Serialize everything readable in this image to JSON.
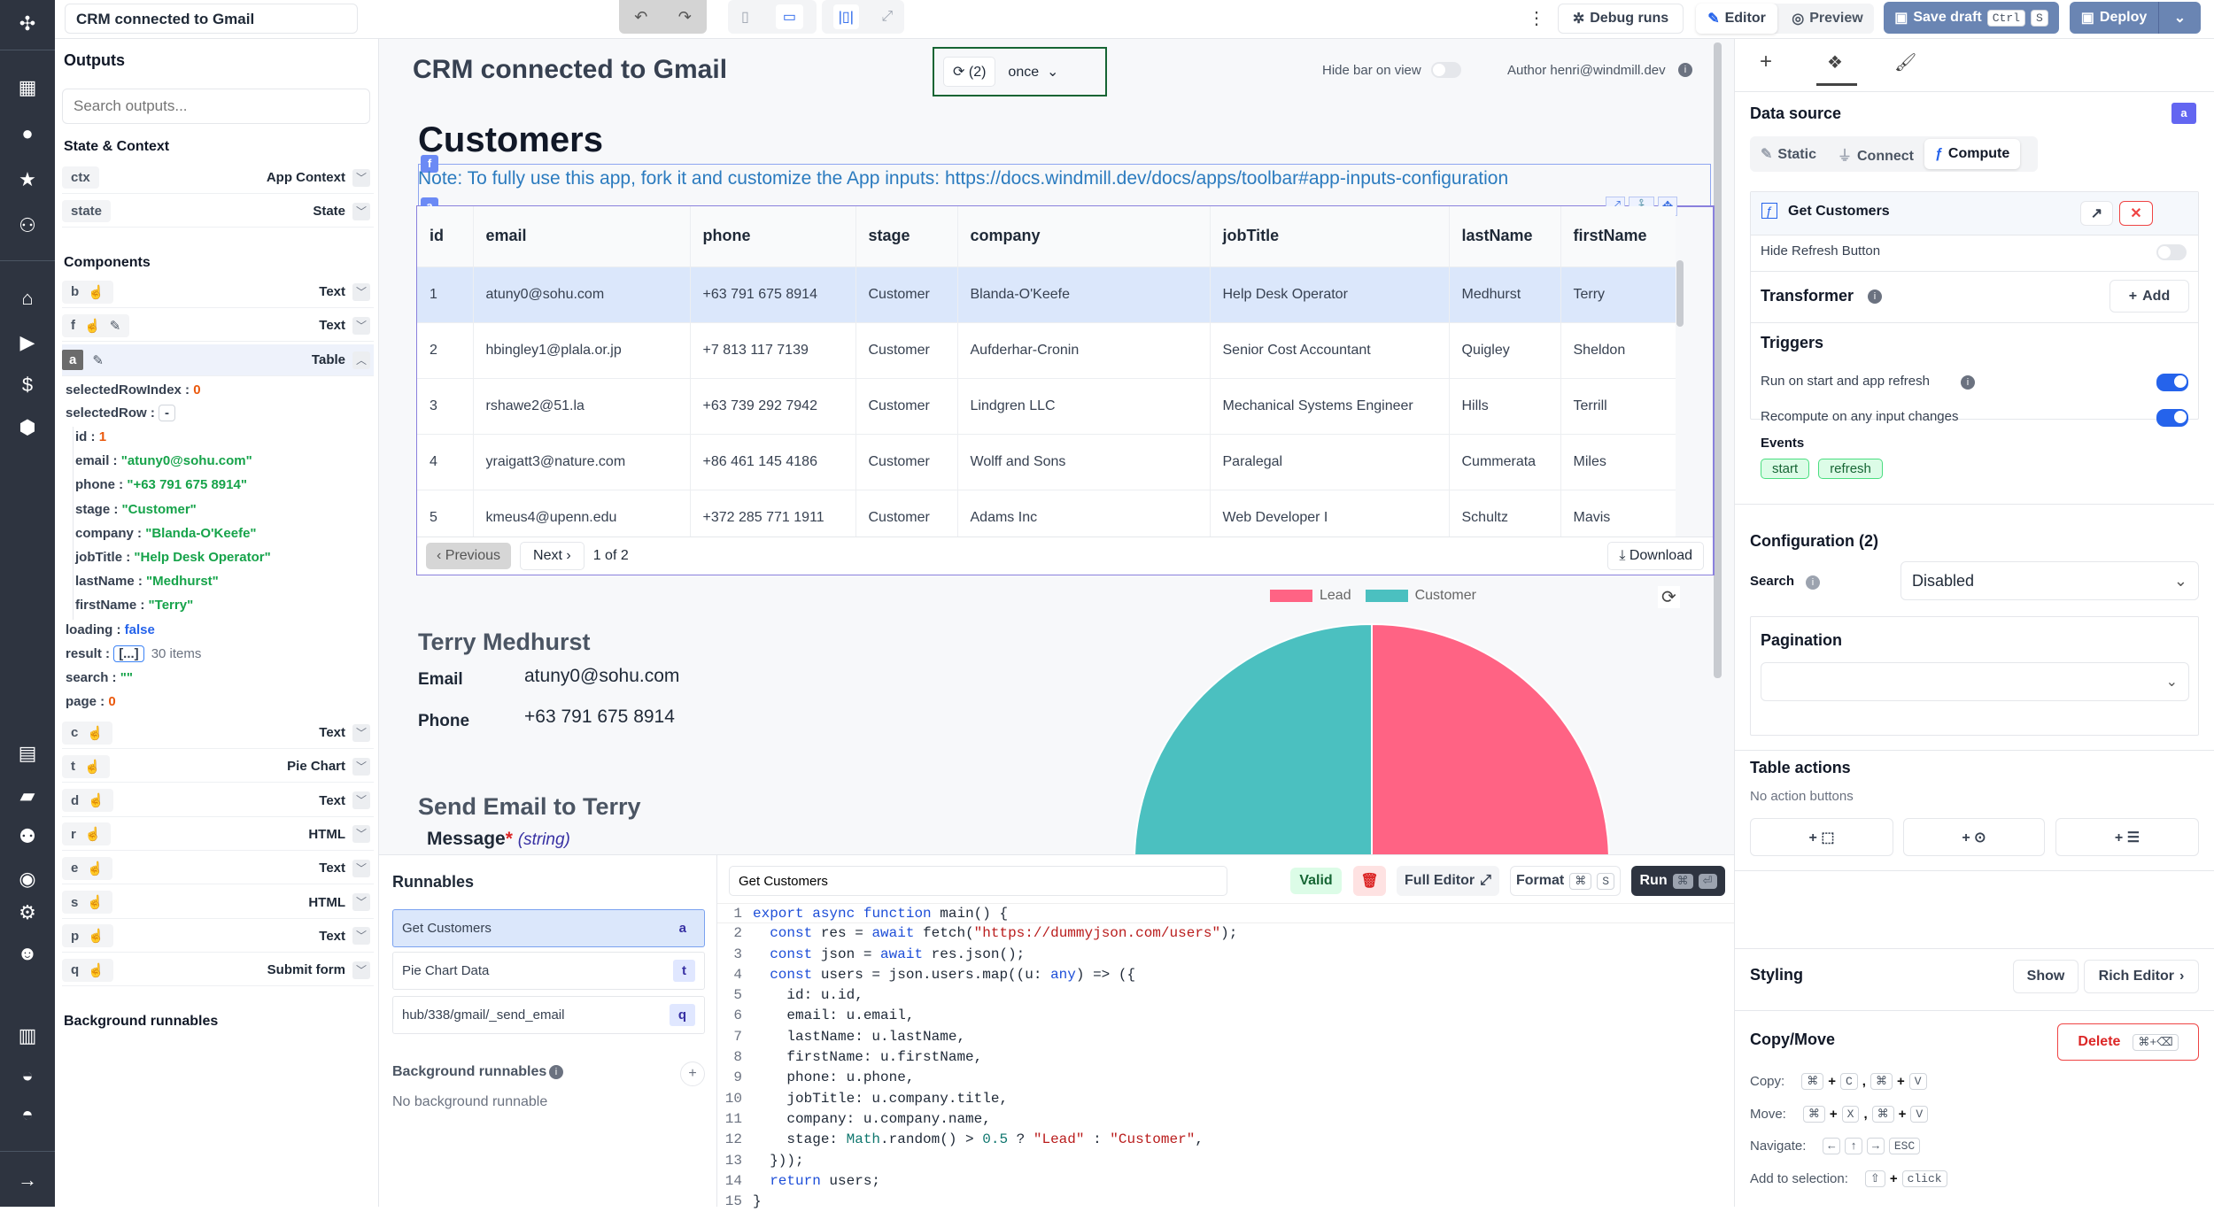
{
  "app": {
    "title": "CRM connected to Gmail"
  },
  "nav": {
    "icons": [
      "windmill-logo-icon",
      "building-icon",
      "user-icon",
      "star-icon",
      "users-icon",
      "home-icon",
      "play-icon",
      "dollar-icon",
      "cubes-icon",
      "calendar-icon",
      "folder-icon",
      "user-group-icon",
      "eye-icon",
      "gear-icon",
      "robot-icon",
      "book-icon",
      "discord-icon",
      "github-icon",
      "arrow-right-icon"
    ]
  },
  "topbar": {
    "debug_runs": "Debug runs",
    "editor": "Editor",
    "preview": "Preview",
    "save_draft": "Save draft",
    "save_kbd1": "Ctrl",
    "save_kbd2": "S",
    "deploy": "Deploy"
  },
  "outputs": {
    "title": "Outputs",
    "search_placeholder": "Search outputs...",
    "state_title": "State & Context",
    "state_items": [
      {
        "id": "ctx",
        "type": "App Context"
      },
      {
        "id": "state",
        "type": "State"
      }
    ],
    "components_title": "Components",
    "components_top": [
      {
        "id": "b",
        "type": "Text"
      },
      {
        "id": "f",
        "type": "Text"
      },
      {
        "id": "a",
        "type": "Table"
      }
    ],
    "table_outputs": {
      "selectedRowIndex": "0",
      "selectedRow_btn": "-",
      "row": [
        [
          "id",
          "1"
        ],
        [
          "email",
          "\"atuny0@sohu.com\""
        ],
        [
          "phone",
          "\"+63 791 675 8914\""
        ],
        [
          "stage",
          "\"Customer\""
        ],
        [
          "company",
          "\"Blanda-O'Keefe\""
        ],
        [
          "jobTitle",
          "\"Help Desk Operator\""
        ],
        [
          "lastName",
          "\"Medhurst\""
        ],
        [
          "firstName",
          "\"Terry\""
        ]
      ],
      "loading": "false",
      "result_btn": "[...]",
      "result_count": "30 items",
      "search": "\"\"",
      "page": "0"
    },
    "components_bottom": [
      {
        "id": "c",
        "type": "Text"
      },
      {
        "id": "t",
        "type": "Pie Chart"
      },
      {
        "id": "d",
        "type": "Text"
      },
      {
        "id": "r",
        "type": "HTML"
      },
      {
        "id": "e",
        "type": "Text"
      },
      {
        "id": "s",
        "type": "HTML"
      },
      {
        "id": "p",
        "type": "Text"
      },
      {
        "id": "q",
        "type": "Submit form"
      }
    ],
    "background_title": "Background runnables"
  },
  "canvas": {
    "title": "CRM connected to Gmail",
    "refresh_count": "(2)",
    "refresh_mode": "once",
    "hide_bar": "Hide bar on view",
    "author": "Author henri@windmill.dev",
    "heading": "Customers",
    "note": "Note: To fully use this app, fork it and customize the App inputs: https://docs.windmill.dev/docs/apps/toolbar#app-inputs-configuration",
    "badge_f": "f",
    "badge_a": "a",
    "table": {
      "columns": [
        "id",
        "email",
        "phone",
        "stage",
        "company",
        "jobTitle",
        "lastName",
        "firstName"
      ],
      "rows": [
        [
          "1",
          "atuny0@sohu.com",
          "+63 791 675 8914",
          "Customer",
          "Blanda-O'Keefe",
          "Help Desk Operator",
          "Medhurst",
          "Terry"
        ],
        [
          "2",
          "hbingley1@plala.or.jp",
          "+7 813 117 7139",
          "Customer",
          "Aufderhar-Cronin",
          "Senior Cost Accountant",
          "Quigley",
          "Sheldon"
        ],
        [
          "3",
          "rshawe2@51.la",
          "+63 739 292 7942",
          "Customer",
          "Lindgren LLC",
          "Mechanical Systems Engineer",
          "Hills",
          "Terrill"
        ],
        [
          "4",
          "yraigatt3@nature.com",
          "+86 461 145 4186",
          "Customer",
          "Wolff and Sons",
          "Paralegal",
          "Cummerata",
          "Miles"
        ],
        [
          "5",
          "kmeus4@upenn.edu",
          "+372 285 771 1911",
          "Customer",
          "Adams Inc",
          "Web Developer I",
          "Schultz",
          "Mavis"
        ]
      ],
      "selected_row": 0,
      "prev": "‹ Previous",
      "next": "Next ›",
      "page_info": "1 of 2",
      "download": "Download"
    },
    "detail": {
      "name": "Terry Medhurst",
      "email_label": "Email",
      "email": "atuny0@sohu.com",
      "phone_label": "Phone",
      "phone": "+63 791 675 8914",
      "send_title": "Send Email to Terry",
      "message_label": "Message",
      "message_req": "*",
      "message_type": "(string)"
    }
  },
  "chart_data": {
    "type": "pie",
    "categories": [
      "Lead",
      "Customer"
    ],
    "values": [
      14,
      16
    ],
    "colors": [
      "#ff6384",
      "#4bc0c0"
    ],
    "legend": "top"
  },
  "runnables": {
    "title": "Runnables",
    "items": [
      {
        "name": "Get Customers",
        "id": "a"
      },
      {
        "name": "Pie Chart Data",
        "id": "t"
      },
      {
        "name": "hub/338/gmail/_send_email",
        "id": "q"
      }
    ],
    "background_title": "Background runnables",
    "background_empty": "No background runnable"
  },
  "editor": {
    "name": "Get Customers",
    "valid": "Valid",
    "full_editor": "Full Editor",
    "format": "Format",
    "format_kbd": "S",
    "run": "Run",
    "lines": [
      "export async function main() {",
      "  const res = await fetch(\"https://dummyjson.com/users\");",
      "  const json = await res.json();",
      "  const users = json.users.map((u: any) => ({",
      "    id: u.id,",
      "    email: u.email,",
      "    lastName: u.lastName,",
      "    firstName: u.firstName,",
      "    phone: u.phone,",
      "    jobTitle: u.company.title,",
      "    company: u.company.name,",
      "    stage: Math.random() > 0.5 ? \"Lead\" : \"Customer\",",
      "  }));",
      "  return users;",
      "}"
    ]
  },
  "panel": {
    "data_source": "Data source",
    "badge": "a",
    "tabs": [
      "Static",
      "Connect",
      "Compute"
    ],
    "active_tab": "Compute",
    "runnable": "Get Customers",
    "hide_refresh": "Hide Refresh Button",
    "transformer": "Transformer",
    "add": "Add",
    "triggers": "Triggers",
    "run_on_start": "Run on start and app refresh",
    "recompute": "Recompute on any input changes",
    "events": "Events",
    "event_chips": [
      "start",
      "refresh"
    ],
    "configuration": "Configuration (2)",
    "search_label": "Search",
    "search_value": "Disabled",
    "pagination": "Pagination",
    "pagination_value": "",
    "table_actions": "Table actions",
    "no_actions": "No action buttons",
    "styling": "Styling",
    "show": "Show",
    "rich_editor": "Rich Editor",
    "copy_move": "Copy/Move",
    "delete": "Delete",
    "delete_kbd": "⌘+⌫",
    "shortcuts": [
      {
        "label": "Copy:",
        "keys": [
          "⌘",
          "+",
          "C",
          ",",
          "⌘",
          "+",
          "V"
        ]
      },
      {
        "label": "Move:",
        "keys": [
          "⌘",
          "+",
          "X",
          ",",
          "⌘",
          "+",
          "V"
        ]
      },
      {
        "label": "Navigate:",
        "keys": [
          "←",
          "↑",
          "→",
          "ESC"
        ]
      },
      {
        "label": "Add to selection:",
        "keys": [
          "⇧",
          "+",
          "click"
        ]
      }
    ]
  }
}
